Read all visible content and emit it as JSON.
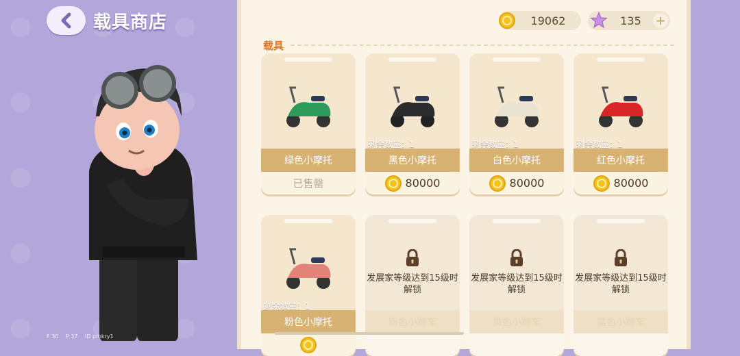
{
  "header": {
    "title": "载具商店"
  },
  "debug": {
    "fps": "F 30",
    "ping": "P 37",
    "id": "ID pmkry1"
  },
  "currency": {
    "coins": "19062",
    "stars": "135",
    "plus": "+"
  },
  "section": {
    "label": "载具"
  },
  "colors": {
    "accent": "#e3742a",
    "name_bar": "#d7b273",
    "panel": "#fbf5e7",
    "bg": "#b3a6da"
  },
  "cards": [
    {
      "name": "绿色小摩托",
      "color": "#2e9a5b",
      "status": "已售罄",
      "stock": "",
      "price": ""
    },
    {
      "name": "黑色小摩托",
      "color": "#2b2b2b",
      "status": "",
      "stock": "剩余数量：1",
      "price": "80000"
    },
    {
      "name": "白色小摩托",
      "color": "#e9e4d2",
      "status": "",
      "stock": "剩余数量：1",
      "price": "80000"
    },
    {
      "name": "红色小摩托",
      "color": "#d8252a",
      "status": "",
      "stock": "剩余数量：1",
      "price": "80000"
    },
    {
      "name": "粉色小摩托",
      "color": "#e2837a",
      "status": "",
      "stock": "剩余数量：1",
      "price": ""
    },
    {
      "name": "粉色小跑车",
      "lock": "发展家等级达到15级时解锁"
    },
    {
      "name": "黄色小跑车",
      "lock": "发展家等级达到15级时解锁"
    },
    {
      "name": "蓝色小跑车",
      "lock": "发展家等级达到15级时解锁"
    }
  ]
}
